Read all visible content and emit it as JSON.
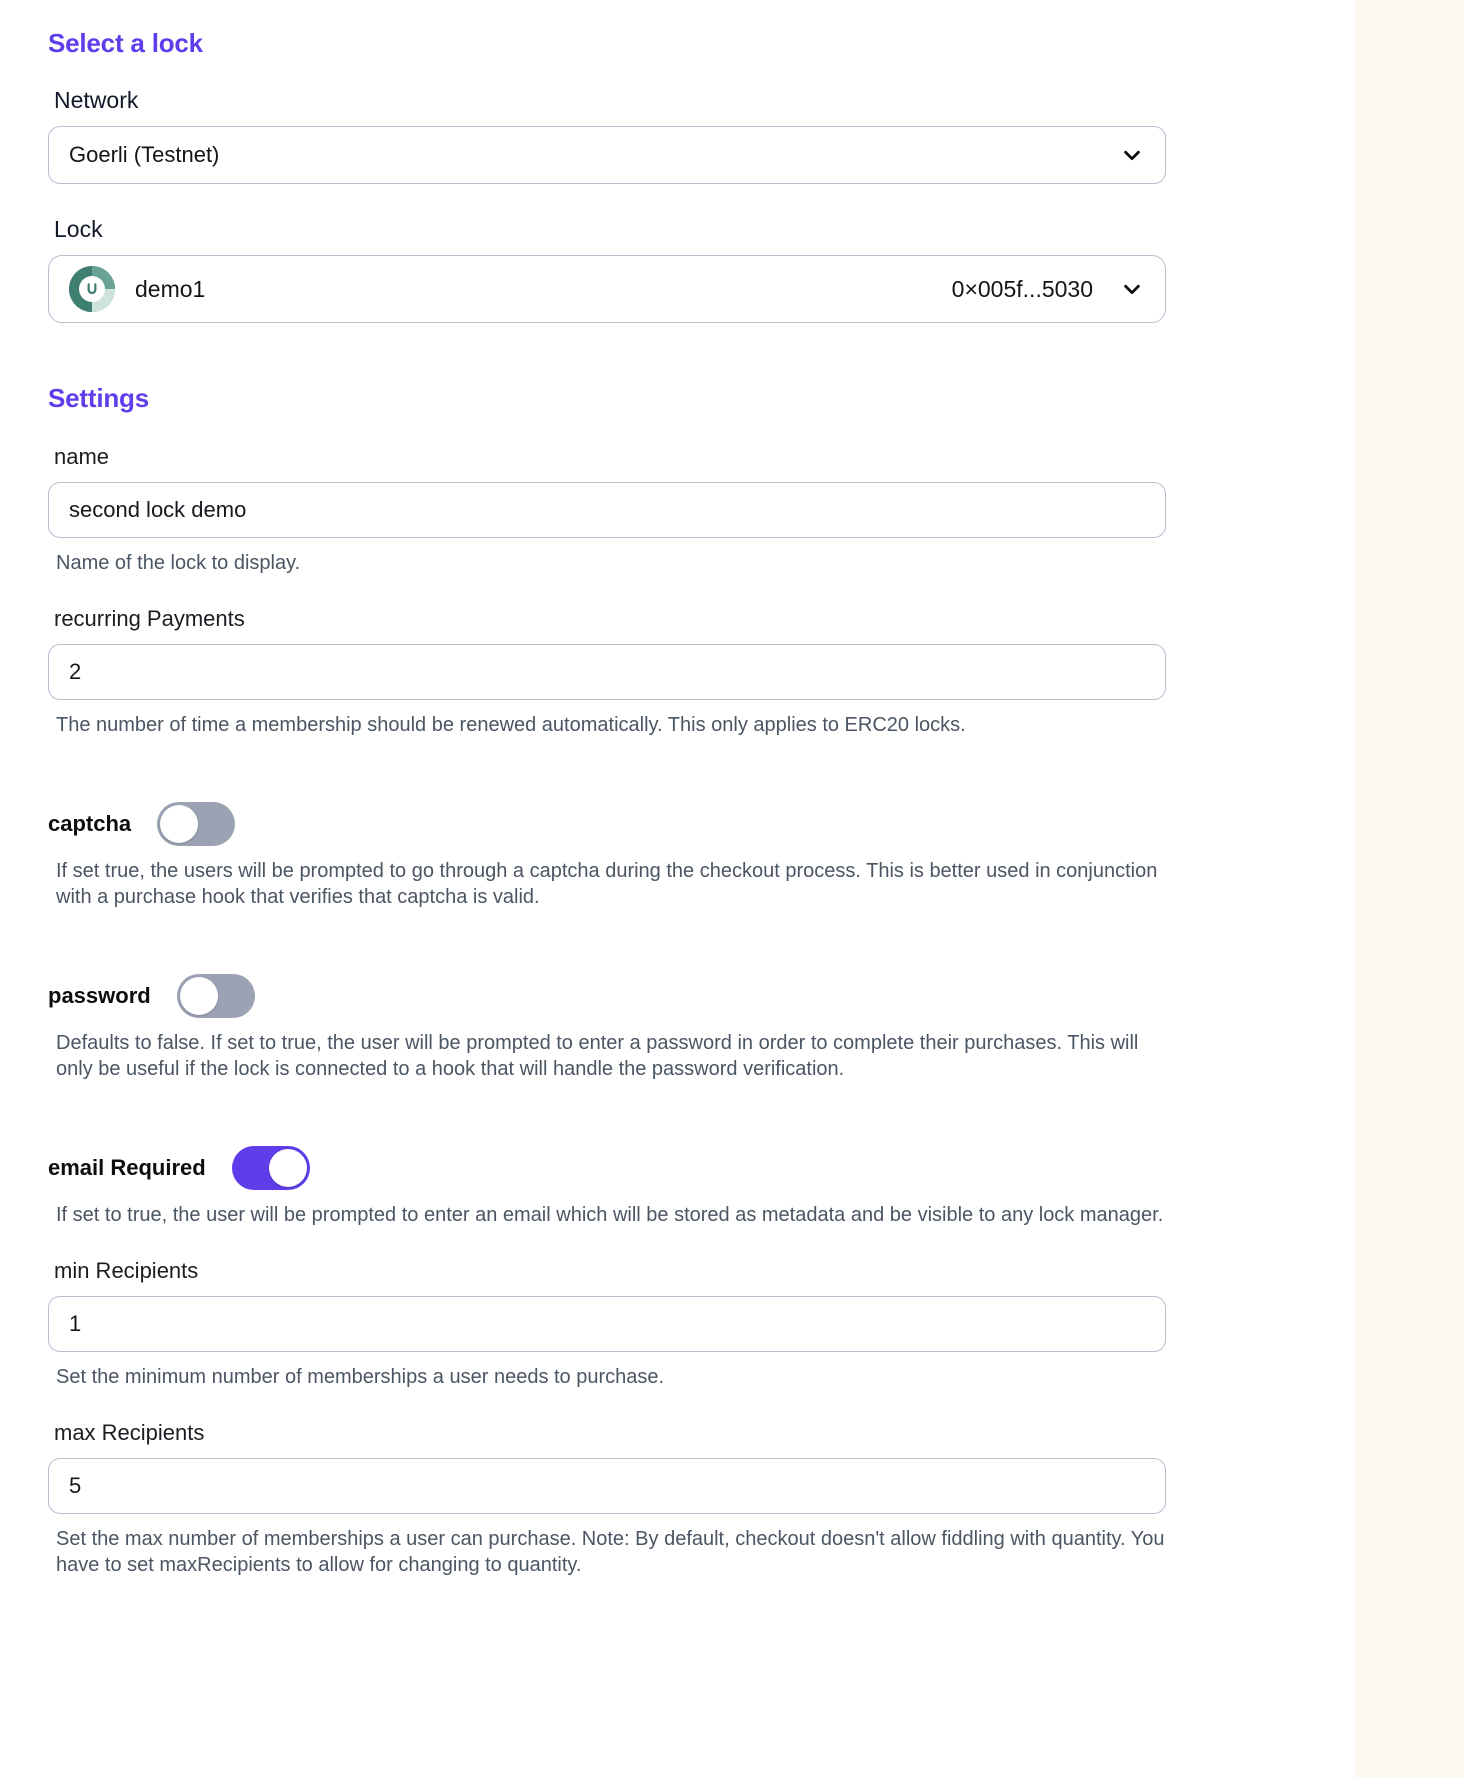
{
  "sections": {
    "select_lock_title": "Select a lock",
    "settings_title": "Settings"
  },
  "network": {
    "label": "Network",
    "value": "Goerli (Testnet)",
    "chevron_icon": "chevron-down-icon"
  },
  "lock": {
    "label": "Lock",
    "name": "demo1",
    "address": "0×005f...5030",
    "avatar_icon": "lock-avatar-icon",
    "chevron_icon": "chevron-down-icon"
  },
  "settings": {
    "name": {
      "label": "name",
      "value": "second lock demo",
      "help": "Name of the lock to display."
    },
    "recurring_payments": {
      "label": "recurring Payments",
      "value": "2",
      "help": "The number of time a membership should be renewed automatically. This only applies to ERC20 locks."
    },
    "captcha": {
      "label": "captcha",
      "state": "off",
      "help": "If set true, the users will be prompted to go through a captcha during the checkout process. This is better used in conjunction with a purchase hook that verifies that captcha is valid."
    },
    "password": {
      "label": "password",
      "state": "off",
      "help": "Defaults to false. If set to true, the user will be prompted to enter a password in order to complete their purchases. This will only be useful if the lock is connected to a hook that will handle the password verification."
    },
    "email_required": {
      "label": "email Required",
      "state": "on",
      "help": "If set to true, the user will be prompted to enter an email which will be stored as metadata and be visible to any lock manager."
    },
    "min_recipients": {
      "label": "min Recipients",
      "value": "1",
      "help": "Set the minimum number of memberships a user needs to purchase."
    },
    "max_recipients": {
      "label": "max Recipients",
      "value": "5",
      "help": "Set the max number of memberships a user can purchase. Note: By default, checkout doesn't allow fiddling with quantity. You have to set maxRecipients to allow for changing to quantity."
    }
  },
  "colors": {
    "accent": "#603deb",
    "toggle_off": "#9aa2b3",
    "page_background": "#fdf8f0",
    "panel_background": "#ffffff",
    "border": "#b8bfd0"
  }
}
